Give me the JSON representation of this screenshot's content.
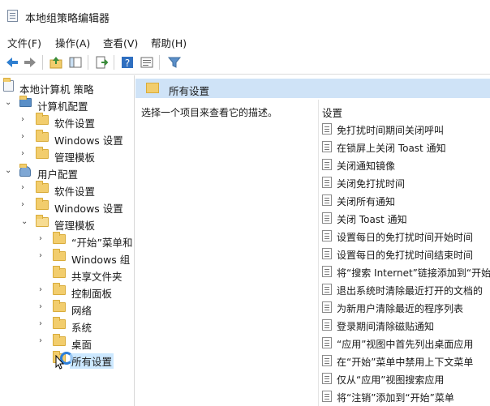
{
  "window": {
    "title": "本地组策略编辑器"
  },
  "menu": [
    {
      "label": "文件(F)"
    },
    {
      "label": "操作(A)"
    },
    {
      "label": "查看(V)"
    },
    {
      "label": "帮助(H)"
    }
  ],
  "toolbar": {
    "icons": [
      "back-arrow-icon",
      "forward-arrow-icon",
      "up-folder-icon",
      "show-hide-tree-icon",
      "export-list-icon",
      "help-icon",
      "properties-icon",
      "filter-icon"
    ]
  },
  "tree": {
    "root": "本地计算机 策略",
    "computer_config": "计算机配置",
    "computer_children": [
      "软件设置",
      "Windows 设置",
      "管理模板"
    ],
    "user_config": "用户配置",
    "user_children": [
      "软件设置",
      "Windows 设置",
      "管理模板"
    ],
    "admin_templates_children": [
      "“开始”菜单和",
      "Windows 组",
      "共享文件夹",
      "控制面板",
      "网络",
      "系统",
      "桌面",
      "所有设置"
    ]
  },
  "panel": {
    "title": "所有设置",
    "description": "选择一个项目来查看它的描述。",
    "column_header": "设置",
    "settings": [
      "免打扰时间期间关闭呼叫",
      "在锁屏上关闭 Toast 通知",
      "关闭通知镜像",
      "关闭免打扰时间",
      "关闭所有通知",
      "关闭 Toast 通知",
      "设置每日的免打扰时间开始时间",
      "设置每日的免打扰时间结束时间",
      "将“搜索 Internet”链接添加到“开始",
      "退出系统时清除最近打开的文档的",
      "为新用户清除最近的程序列表",
      "登录期间清除磁贴通知",
      "“应用”视图中首先列出桌面应用",
      "在“开始”菜单中禁用上下文菜单",
      "仅从“应用”视图搜索应用",
      "将“注销”添加到“开始”菜单"
    ]
  },
  "colors": {
    "header_bg": "#cfe3f7",
    "selection_bg": "#cce8ff",
    "folder": "#f2cd6d",
    "busy_cursor": "#2e7fd9"
  }
}
